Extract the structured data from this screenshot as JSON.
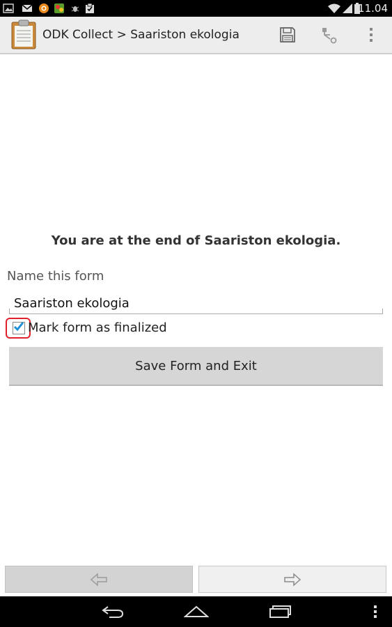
{
  "status_bar": {
    "time": "11.04",
    "icons": [
      "image-icon",
      "gmail-icon",
      "orange-app-icon",
      "game-app-icon",
      "bug-icon",
      "clipboard-check-icon",
      "wifi-icon",
      "signal-icon",
      "battery-icon"
    ]
  },
  "action_bar": {
    "title": "ODK Collect > Saariston ekologia",
    "icons": [
      "clipboard-app-icon",
      "save-icon",
      "hierarchy-icon",
      "overflow-menu-icon"
    ]
  },
  "main": {
    "end_message": "You are at the end of Saariston ekologia.",
    "name_label": "Name this form",
    "name_value": "Saariston ekologia",
    "finalize_label": "Mark form as finalized",
    "finalize_checked": true,
    "save_button_label": "Save Form and Exit"
  },
  "bottom_nav": {
    "icons": [
      "arrow-left-icon",
      "arrow-right-icon"
    ]
  },
  "system_nav": {
    "icons": [
      "back-icon",
      "home-icon",
      "recents-icon",
      "menu-icon"
    ]
  },
  "colors": {
    "checkbox_check": "#1e90d8",
    "highlight": "#e0202a"
  }
}
